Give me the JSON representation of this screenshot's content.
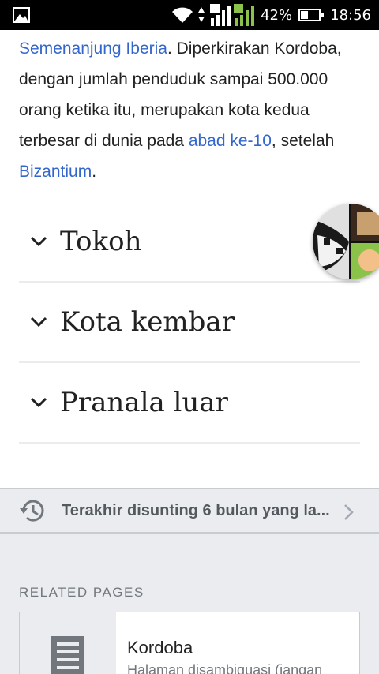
{
  "status_bar": {
    "battery_percent": "42%",
    "battery_level": 0.42,
    "time": "18:56",
    "sim1_label": "1",
    "sim2_label": "2"
  },
  "article": {
    "p1_link1": "Semenanjung Iberia",
    "p1_text1": ". Diperkirakan Kordoba, dengan jumlah penduduk sampai 500.000 orang ketika itu, merupakan kota kedua terbesar di dunia pada ",
    "p1_link2": "abad ke-10",
    "p1_text2": ", setelah ",
    "p1_link3": "Bizantium",
    "p1_text3": "."
  },
  "sections": [
    {
      "title": "Tokoh"
    },
    {
      "title": "Kota kembar"
    },
    {
      "title": "Pranala luar"
    }
  ],
  "footer": {
    "last_edited": "Terakhir disunting 6 bulan yang la...",
    "related_heading": "RELATED PAGES",
    "related": [
      {
        "title": "Kordoba",
        "description": "Halaman disambiguasi (jangan"
      }
    ]
  },
  "colors": {
    "link": "#3366cc",
    "text": "#202122",
    "divider": "#eaecf0",
    "footer_bg": "#eaecf0",
    "muted": "#72777d"
  },
  "icons": [
    "image-icon",
    "wifi-icon",
    "signal-icon",
    "battery-icon",
    "chevron-down-icon",
    "history-icon",
    "chevron-right-icon",
    "article-icon"
  ]
}
